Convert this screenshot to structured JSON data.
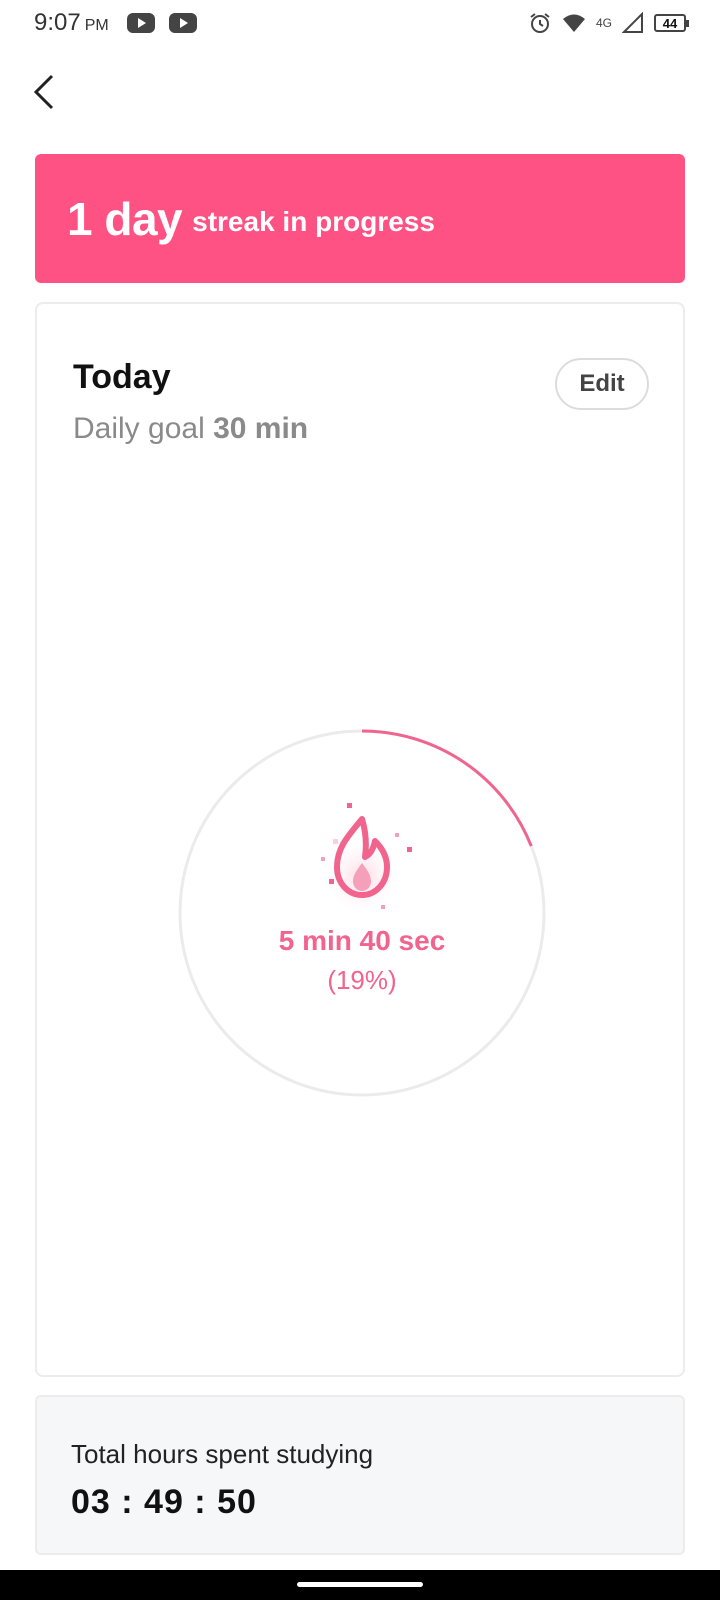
{
  "status_bar": {
    "time": "9:07",
    "ampm": "PM",
    "network": "4G",
    "battery": "44",
    "icons": [
      "youtube-icon",
      "youtube-icon",
      "alarm-icon",
      "wifi-icon",
      "signal-icon",
      "battery-icon"
    ]
  },
  "streak": {
    "count": "1 day",
    "text": "streak in progress",
    "color": "#ff5284"
  },
  "today": {
    "title": "Today",
    "goal_prefix": "Daily goal",
    "goal_value": "30 min",
    "edit_label": "Edit",
    "progress_time": "5 min 40 sec",
    "progress_percent": "(19%)",
    "progress_fraction": 0.19,
    "accent_color": "#f0648e"
  },
  "total": {
    "label": "Total hours spent studying",
    "value": "03 : 49 : 50"
  }
}
